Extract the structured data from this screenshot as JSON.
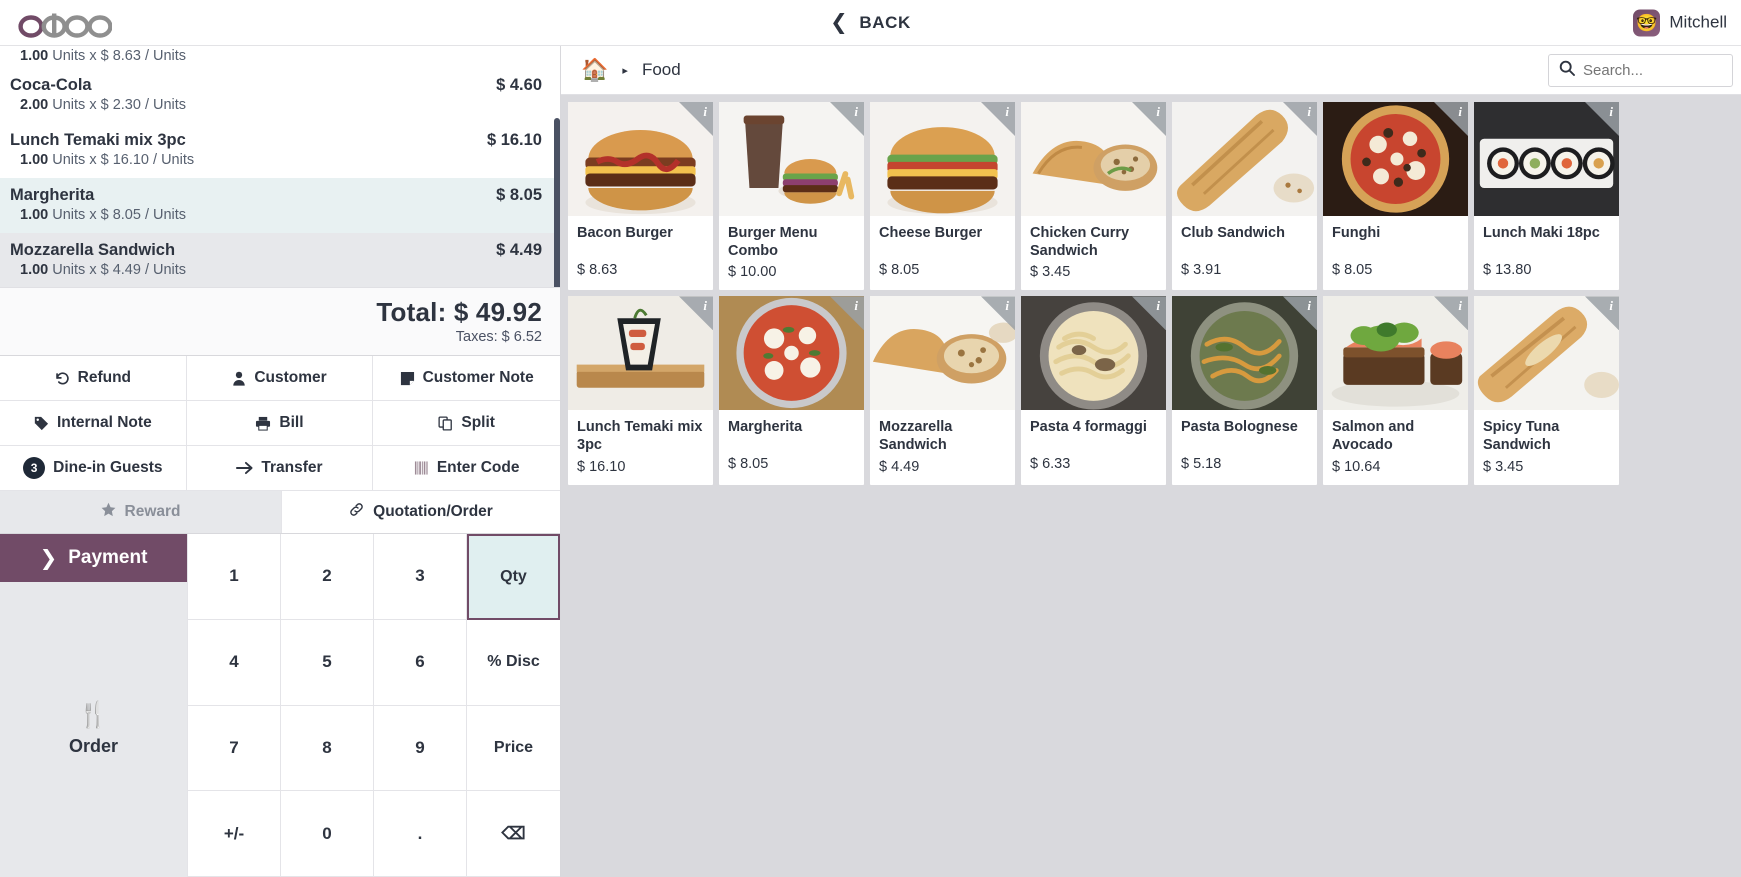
{
  "topbar": {
    "logo_text": "odoo",
    "back_label": "BACK",
    "back_icon": "chevron-left-icon",
    "user_name": "Mitchell",
    "avatar_glyph": "🤓"
  },
  "order": {
    "lines": [
      {
        "name": "",
        "price": "",
        "qty": "1.00",
        "unit_text": "Units x $ 8.63 / Units",
        "state": "partial"
      },
      {
        "name": "Coca-Cola",
        "price": "$ 4.60",
        "qty": "2.00",
        "unit_text": "Units x $ 2.30 / Units",
        "state": "normal"
      },
      {
        "name": "Lunch Temaki mix 3pc",
        "price": "$ 16.10",
        "qty": "1.00",
        "unit_text": "Units x $ 16.10 / Units",
        "state": "normal"
      },
      {
        "name": "Margherita",
        "price": "$ 8.05",
        "qty": "1.00",
        "unit_text": "Units x $ 8.05 / Units",
        "state": "selected"
      },
      {
        "name": "Mozzarella Sandwich",
        "price": "$ 4.49",
        "qty": "1.00",
        "unit_text": "Units x $ 4.49 / Units",
        "state": "alt"
      }
    ],
    "total_label": "Total: $ 49.92",
    "taxes_label": "Taxes: $ 6.52"
  },
  "actions": [
    {
      "label": "Refund",
      "icon": "refund-icon"
    },
    {
      "label": "Customer",
      "icon": "person-icon"
    },
    {
      "label": "Customer Note",
      "icon": "note-icon"
    },
    {
      "label": "Internal Note",
      "icon": "tag-icon"
    },
    {
      "label": "Bill",
      "icon": "printer-icon"
    },
    {
      "label": "Split",
      "icon": "split-icon"
    },
    {
      "label": "Dine-in Guests",
      "icon": "guests-badge-icon",
      "badge": "3"
    },
    {
      "label": "Transfer",
      "icon": "arrow-right-icon"
    },
    {
      "label": "Enter Code",
      "icon": "barcode-icon"
    }
  ],
  "reward_row": {
    "reward_label": "Reward",
    "reward_icon": "star-icon",
    "quotation_label": "Quotation/Order",
    "quotation_icon": "link-icon"
  },
  "payment": {
    "payment_label": "Payment",
    "payment_icon": "chevron-right-icon",
    "payment_color": "#714b67",
    "order_label": "Order",
    "order_icon": "cutlery-icon"
  },
  "numpad": {
    "keys": [
      {
        "label": "1",
        "active": false
      },
      {
        "label": "2",
        "active": false
      },
      {
        "label": "3",
        "active": false
      },
      {
        "label": "Qty",
        "active": true
      },
      {
        "label": "4",
        "active": false
      },
      {
        "label": "5",
        "active": false
      },
      {
        "label": "6",
        "active": false
      },
      {
        "label": "% Disc",
        "active": false
      },
      {
        "label": "7",
        "active": false
      },
      {
        "label": "8",
        "active": false
      },
      {
        "label": "9",
        "active": false
      },
      {
        "label": "Price",
        "active": false
      },
      {
        "label": "+/-",
        "active": false
      },
      {
        "label": "0",
        "active": false
      },
      {
        "label": ".",
        "active": false
      },
      {
        "label": "⌫",
        "active": false
      }
    ],
    "active_color": "#e0eff0"
  },
  "products_header": {
    "home_icon": "home-icon",
    "separator_icon": "caret-right-icon",
    "breadcrumb": "Food",
    "search_icon": "search-icon",
    "search_placeholder": "Search...",
    "search_value": ""
  },
  "products": [
    {
      "name": "Bacon Burger",
      "price": "$ 8.63",
      "img": "burger",
      "info_icon": "info-icon"
    },
    {
      "name": "Burger Menu Combo",
      "price": "$ 10.00",
      "img": "combo",
      "info_icon": "info-icon"
    },
    {
      "name": "Cheese Burger",
      "price": "$ 8.05",
      "img": "burger2",
      "info_icon": "info-icon"
    },
    {
      "name": "Chicken Curry Sandwich",
      "price": "$ 3.45",
      "img": "sandwich",
      "info_icon": "info-icon"
    },
    {
      "name": "Club Sandwich",
      "price": "$ 3.91",
      "img": "baguette",
      "info_icon": "info-icon"
    },
    {
      "name": "Funghi",
      "price": "$ 8.05",
      "img": "pizza",
      "info_icon": "info-icon"
    },
    {
      "name": "Lunch Maki 18pc",
      "price": "$ 13.80",
      "img": "maki",
      "info_icon": "info-icon"
    },
    {
      "name": "Lunch Temaki mix 3pc",
      "price": "$ 16.10",
      "img": "temaki",
      "info_icon": "info-icon"
    },
    {
      "name": "Margherita",
      "price": "$ 8.05",
      "img": "pizza2",
      "info_icon": "info-icon"
    },
    {
      "name": "Mozzarella Sandwich",
      "price": "$ 4.49",
      "img": "mozza",
      "info_icon": "info-icon"
    },
    {
      "name": "Pasta 4 formaggi",
      "price": "$ 6.33",
      "img": "pasta",
      "info_icon": "info-icon"
    },
    {
      "name": "Pasta Bolognese",
      "price": "$ 5.18",
      "img": "pastabol",
      "info_icon": "info-icon"
    },
    {
      "name": "Salmon and Avocado",
      "price": "$ 10.64",
      "img": "salmon",
      "info_icon": "info-icon"
    },
    {
      "name": "Spicy Tuna Sandwich",
      "price": "$ 3.45",
      "img": "tuna",
      "info_icon": "info-icon"
    }
  ]
}
